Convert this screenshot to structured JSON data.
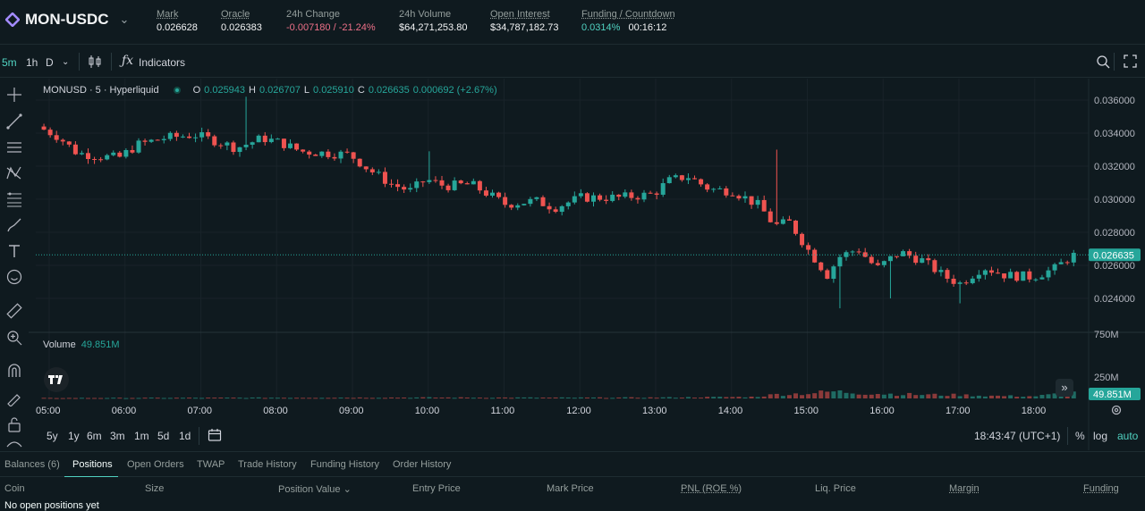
{
  "header": {
    "pair": "MON-USDC",
    "mark_label": "Mark",
    "mark_value": "0.026628",
    "oracle_label": "Oracle",
    "oracle_value": "0.026383",
    "change_label": "24h Change",
    "change_value": "-0.007180 / -21.24%",
    "volume_label": "24h Volume",
    "volume_value": "$64,271,253.80",
    "oi_label": "Open Interest",
    "oi_value": "$34,787,182.73",
    "funding_label": "Funding / Countdown",
    "funding_value": "0.0314%",
    "countdown_value": "00:16:12"
  },
  "toolbar": {
    "timeframes": [
      "5m",
      "1h",
      "D"
    ],
    "indicators_label": "Indicators"
  },
  "legend": {
    "symbol": "MONUSD · 5 · Hyperliquid",
    "o_label": "O",
    "o_value": "0.025943",
    "h_label": "H",
    "h_value": "0.026707",
    "l_label": "L",
    "l_value": "0.025910",
    "c_label": "C",
    "c_value": "0.026635",
    "change": "0.000692 (+2.67%)"
  },
  "volume": {
    "label": "Volume",
    "value": "49.851M"
  },
  "chart_data": {
    "type": "candlestick",
    "price_ticks": [
      "0.036000",
      "0.034000",
      "0.032000",
      "0.030000",
      "0.028000",
      "0.026000",
      "0.024000"
    ],
    "price_tick_values": [
      0.036,
      0.034,
      0.032,
      0.03,
      0.028,
      0.026,
      0.024
    ],
    "volume_ticks": [
      "750M",
      "250M"
    ],
    "volume_tick_values": [
      750,
      250
    ],
    "time_ticks": [
      "05:00",
      "06:00",
      "07:00",
      "08:00",
      "09:00",
      "10:00",
      "11:00",
      "12:00",
      "13:00",
      "14:00",
      "15:00",
      "16:00",
      "17:00",
      "18:00"
    ],
    "last_price": "0.026635",
    "last_price_value": 0.026635,
    "last_volume": "49.851M",
    "last_volume_value": 49.851,
    "path": [
      [
        4.93,
        0.0344
      ],
      [
        5.2,
        0.0338
      ],
      [
        5.45,
        0.0328
      ],
      [
        5.75,
        0.0326
      ],
      [
        6.0,
        0.0325
      ],
      [
        6.25,
        0.0333
      ],
      [
        6.6,
        0.0337
      ],
      [
        7.0,
        0.0339
      ],
      [
        7.3,
        0.0335
      ],
      [
        7.55,
        0.0331
      ],
      [
        7.9,
        0.0337
      ],
      [
        8.15,
        0.0334
      ],
      [
        8.4,
        0.0329
      ],
      [
        8.7,
        0.0328
      ],
      [
        9.05,
        0.0327
      ],
      [
        9.3,
        0.0318
      ],
      [
        9.6,
        0.0309
      ],
      [
        9.85,
        0.0305
      ],
      [
        10.05,
        0.0312
      ],
      [
        10.3,
        0.0308
      ],
      [
        10.65,
        0.0309
      ],
      [
        11.1,
        0.0297
      ],
      [
        11.5,
        0.0299
      ],
      [
        11.75,
        0.0295
      ],
      [
        12.1,
        0.0301
      ],
      [
        12.6,
        0.0301
      ],
      [
        13.05,
        0.0303
      ],
      [
        13.25,
        0.0311
      ],
      [
        13.5,
        0.0314
      ],
      [
        13.8,
        0.0306
      ],
      [
        14.1,
        0.0305
      ],
      [
        14.45,
        0.0296
      ],
      [
        14.65,
        0.0284
      ],
      [
        14.85,
        0.0286
      ],
      [
        15.1,
        0.0269
      ],
      [
        15.35,
        0.0254
      ],
      [
        15.5,
        0.0265
      ],
      [
        15.75,
        0.027
      ],
      [
        16.0,
        0.0258
      ],
      [
        16.3,
        0.0268
      ],
      [
        16.6,
        0.0263
      ],
      [
        16.9,
        0.0253
      ],
      [
        17.1,
        0.0249
      ],
      [
        17.4,
        0.0259
      ],
      [
        17.7,
        0.0254
      ],
      [
        18.05,
        0.0253
      ],
      [
        18.35,
        0.0258
      ],
      [
        18.57,
        0.0266
      ]
    ],
    "volume_profile": [
      [
        4.93,
        3
      ],
      [
        8.0,
        5
      ],
      [
        10.0,
        6
      ],
      [
        12.0,
        5
      ],
      [
        13.0,
        6
      ],
      [
        14.3,
        10
      ],
      [
        14.6,
        26
      ],
      [
        15.0,
        32
      ],
      [
        15.35,
        45
      ],
      [
        15.7,
        35
      ],
      [
        16.0,
        30
      ],
      [
        16.5,
        24
      ],
      [
        17.0,
        22
      ],
      [
        17.5,
        16
      ],
      [
        18.0,
        14
      ],
      [
        18.57,
        40
      ]
    ]
  },
  "bottom": {
    "ranges": [
      "5y",
      "1y",
      "6m",
      "3m",
      "1m",
      "5d",
      "1d"
    ],
    "clock": "18:43:47 (UTC+1)",
    "percent": "%",
    "log": "log",
    "auto": "auto"
  },
  "tabs": [
    "Balances (6)",
    "Positions",
    "Open Orders",
    "TWAP",
    "Trade History",
    "Funding History",
    "Order History"
  ],
  "columns": [
    "Coin",
    "Size",
    "Position Value",
    "Entry Price",
    "Mark Price",
    "PNL (ROE %)",
    "Liq. Price",
    "Margin",
    "Funding"
  ],
  "empty_text": "No open positions yet",
  "colors": {
    "up": "#26a69a",
    "down": "#ef5350",
    "accent": "#50d2c1"
  }
}
